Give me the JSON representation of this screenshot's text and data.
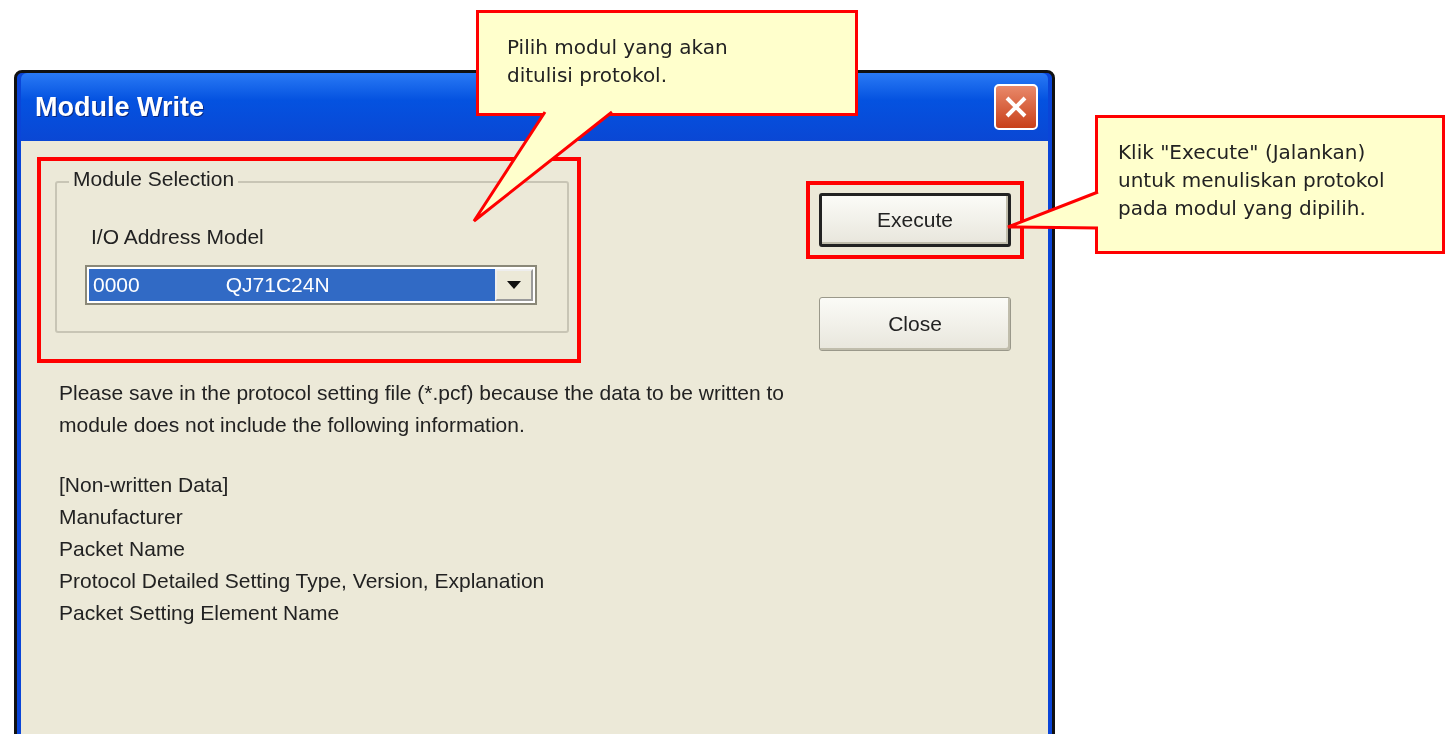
{
  "window": {
    "title": "Module Write"
  },
  "module_selection": {
    "legend": "Module Selection",
    "label": "I/O Address Model",
    "highlighted": true,
    "dropdown": {
      "address": "0000",
      "model": "QJ71C24N",
      "selected": true
    }
  },
  "buttons": [
    {
      "label": "Execute",
      "default": true,
      "highlighted": true
    },
    {
      "label": "Close",
      "default": false,
      "highlighted": false
    }
  ],
  "message": "Please save in the protocol setting file (*.pcf) because the data to be written to\nmodule does not include the following information.",
  "info_lines": [
    "[Non-written Data]",
    "Manufacturer",
    "Packet Name",
    "Protocol Detailed Setting Type, Version, Explanation",
    "Packet Setting Element Name"
  ],
  "callouts": [
    {
      "text": "Pilih modul yang akan\nditulisi protokol."
    },
    {
      "text": "Klik \"Execute\" (Jalankan)\nuntuk menuliskan protokol\npada modul yang dipilih."
    }
  ]
}
